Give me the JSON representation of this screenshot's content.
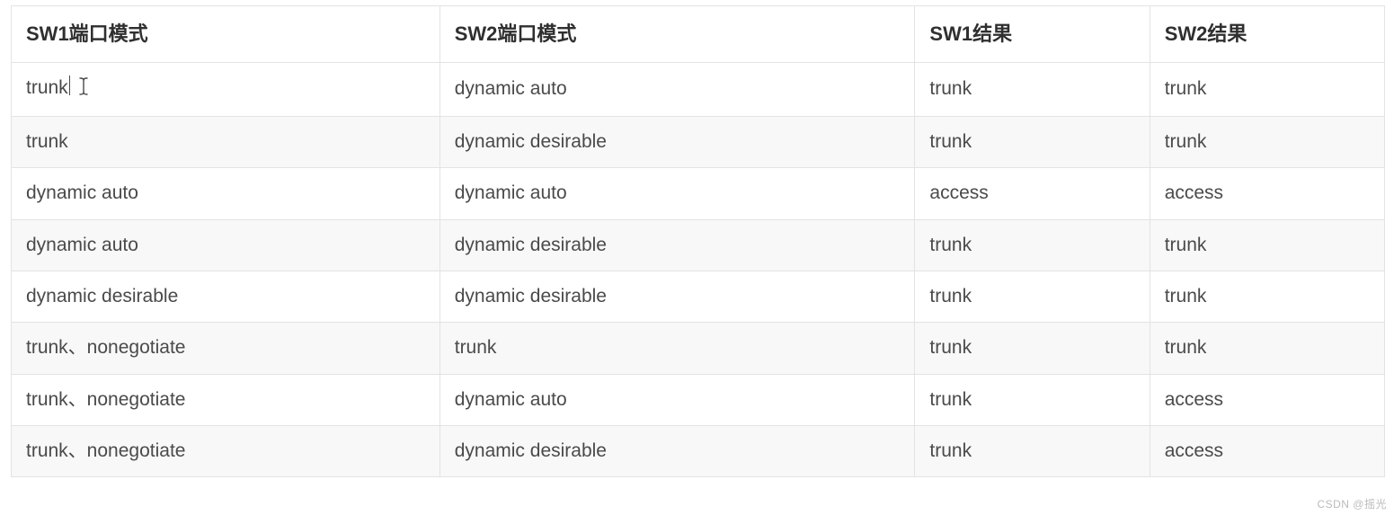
{
  "table": {
    "headers": [
      "SW1端口模式",
      "SW2端口模式",
      "SW1结果",
      "SW2结果"
    ],
    "rows": [
      {
        "cells": [
          "trunk",
          "dynamic auto",
          "trunk",
          "trunk"
        ],
        "cursor_after_first": true
      },
      {
        "cells": [
          "trunk",
          "dynamic desirable",
          "trunk",
          "trunk"
        ]
      },
      {
        "cells": [
          "dynamic auto",
          "dynamic auto",
          "access",
          "access"
        ]
      },
      {
        "cells": [
          "dynamic auto",
          "dynamic desirable",
          "trunk",
          "trunk"
        ]
      },
      {
        "cells": [
          "dynamic desirable",
          "dynamic desirable",
          "trunk",
          "trunk"
        ]
      },
      {
        "cells": [
          "trunk、nonegotiate",
          "trunk",
          "trunk",
          "trunk"
        ]
      },
      {
        "cells": [
          "trunk、nonegotiate",
          "dynamic auto",
          "trunk",
          "access"
        ]
      },
      {
        "cells": [
          "trunk、nonegotiate",
          "dynamic desirable",
          "trunk",
          "access"
        ]
      }
    ]
  },
  "watermark": "CSDN @摇光"
}
